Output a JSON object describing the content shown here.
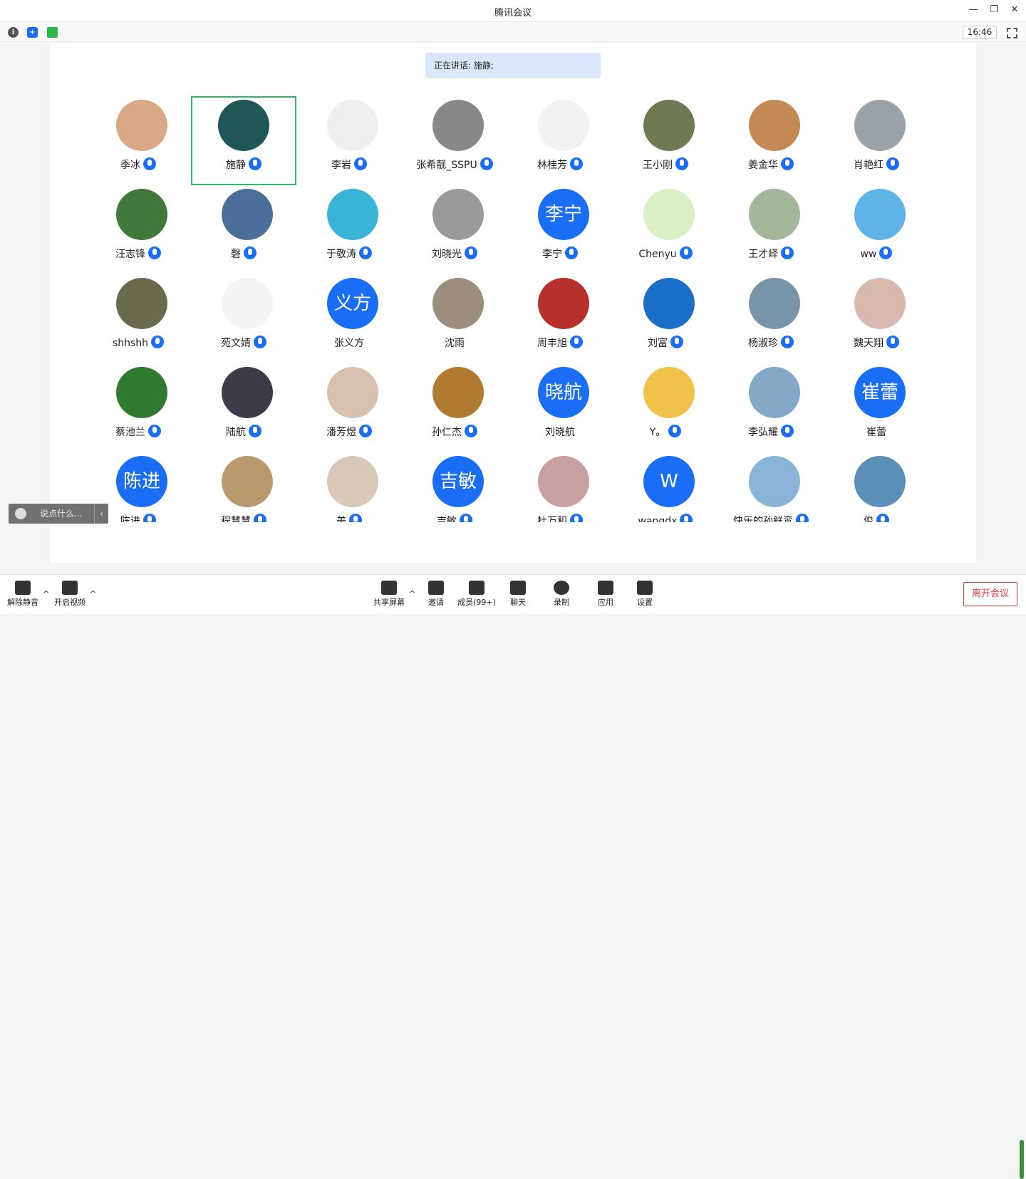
{
  "window": {
    "title": "腾讯会议"
  },
  "topbar": {
    "time": "16:46"
  },
  "stage": {
    "speaking": "正在讲话: 施静;"
  },
  "participants": [
    {
      "name": "季冰",
      "bg": "#d9a884"
    },
    {
      "name": "施静",
      "bg": "#1f5656",
      "active": true
    },
    {
      "name": "李岩",
      "bg": "#efefef"
    },
    {
      "name": "张希靓_SSPU",
      "bg": "#888"
    },
    {
      "name": "林桂芳",
      "bg": "#f2f2f2"
    },
    {
      "name": "王小刚",
      "bg": "#6d7a52"
    },
    {
      "name": "姜金华",
      "bg": "#c48a55"
    },
    {
      "name": "肖艳红",
      "bg": "#9aa3a8"
    },
    {
      "name": "汪志锋",
      "bg": "#3f7a3a"
    },
    {
      "name": "磬",
      "bg": "#4c6f9a"
    },
    {
      "name": "于敬涛",
      "bg": "#39b3d6"
    },
    {
      "name": "刘晓光",
      "bg": "#9a9a9a"
    },
    {
      "name": "李宁",
      "initials": "李宁",
      "bg": "#1a6ef5"
    },
    {
      "name": "Chenyu",
      "bg": "#d9efc4"
    },
    {
      "name": "王才峄",
      "bg": "#a3b79a"
    },
    {
      "name": "ww",
      "bg": "#5fb3e6"
    },
    {
      "name": "shhshh",
      "bg": "#6a6a4e"
    },
    {
      "name": "苑文婧",
      "bg": "#f4f4f4"
    },
    {
      "name": "张义方",
      "initials": "义方",
      "bg": "#1a6ef5"
    },
    {
      "name": "沈雨",
      "bg": "#9b8e7c"
    },
    {
      "name": "周丰旭",
      "bg": "#b8302b"
    },
    {
      "name": "刘富",
      "bg": "#1c6fc9"
    },
    {
      "name": "杨淑珍",
      "bg": "#7894a8"
    },
    {
      "name": "魏天翔",
      "bg": "#d8b9b0"
    },
    {
      "name": "蔡池兰",
      "bg": "#2f7a2f"
    },
    {
      "name": "陆航",
      "bg": "#3b3b4a"
    },
    {
      "name": "潘芳煜",
      "bg": "#d8c0b0"
    },
    {
      "name": "孙仁杰",
      "bg": "#b07a30"
    },
    {
      "name": "刘晓航",
      "initials": "晓航",
      "bg": "#1a6ef5"
    },
    {
      "name": "Y。",
      "bg": "#f1c24a"
    },
    {
      "name": "李弘耀",
      "bg": "#85a8c8"
    },
    {
      "name": "崔蕾",
      "initials": "崔蕾",
      "bg": "#1a6ef5"
    },
    {
      "name": "陈进",
      "initials": "陈进",
      "bg": "#1a6ef5"
    },
    {
      "name": "程慧慧",
      "bg": "#b99a6e"
    },
    {
      "name": "美",
      "bg": "#d8c8b8"
    },
    {
      "name": "吉敏",
      "initials": "吉敏",
      "bg": "#1a6ef5"
    },
    {
      "name": "杜万和",
      "bg": "#c9a0a0"
    },
    {
      "name": "wangdx",
      "initials": "W",
      "bg": "#1a6ef5"
    },
    {
      "name": "快乐的孙鲜鸾",
      "bg": "#89b4d8"
    },
    {
      "name": "俊",
      "bg": "#5b8fb8"
    }
  ],
  "chat": {
    "placeholder": "说点什么..."
  },
  "toolbar": {
    "unmute": "解除静音",
    "video": "开启视频",
    "share": "共享屏幕",
    "invite": "邀请",
    "members": "成员(99+)",
    "chat": "聊天",
    "record": "录制",
    "apps": "应用",
    "settings": "设置",
    "leave": "离开会议"
  }
}
